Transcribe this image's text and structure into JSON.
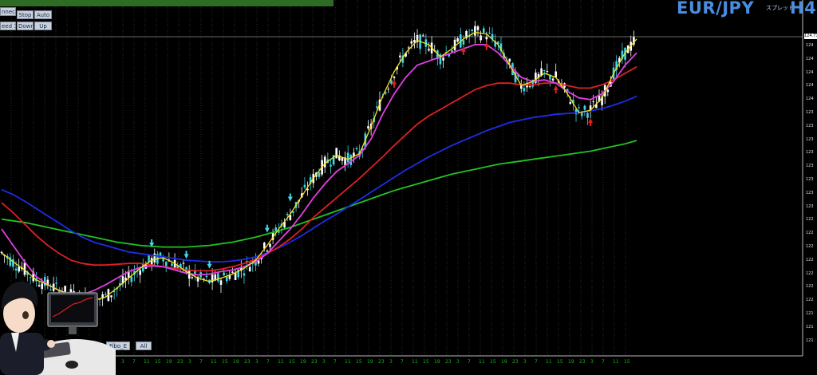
{
  "title": {
    "symbol": "EUR/JPY",
    "subtitle": "スプレット",
    "timeframe": "H4"
  },
  "toolbar": {
    "buttons": [
      {
        "name": "connect-button",
        "label": "nnect"
      },
      {
        "name": "stop-button",
        "label": "Stop"
      },
      {
        "name": "auto-button",
        "label": "Auto"
      },
      {
        "name": "speed-button",
        "label": "eed 1"
      },
      {
        "name": "down-button",
        "label": "Down"
      },
      {
        "name": "up-button",
        "label": "Up"
      }
    ]
  },
  "bottom_buttons": [
    {
      "name": "fibo-e-button",
      "label": "Fibo_E"
    },
    {
      "name": "all-button",
      "label": "All"
    }
  ],
  "colors": {
    "background": "#000000",
    "bull": "#ffffff",
    "bear": "#3fd6e6",
    "sma_fast": "#f5e21b",
    "sma_mid": "#e040e0",
    "sma_red": "#e02020",
    "sma_blue": "#1f2ce8",
    "sma_green": "#22c322",
    "arrow_up": "#e02020",
    "arrow_down": "#3fd6e6",
    "grid": "#555555",
    "axis_text": "#1db31d"
  },
  "chart_data": {
    "type": "line",
    "chart_kind": "candlestick-with-moving-averages",
    "title": "EUR/JPY H4",
    "ylim": [
      121.2,
      124.9
    ],
    "x_tick_labels": [
      "11",
      "15",
      "19",
      "23",
      "3",
      "7",
      "11",
      "15",
      "19",
      "23",
      "3",
      "7",
      "11",
      "15",
      "19",
      "23",
      "3",
      "7",
      "11",
      "15",
      "19",
      "23",
      "3",
      "7",
      "11",
      "15",
      "19",
      "23",
      "3",
      "7",
      "11",
      "15",
      "19",
      "23",
      "3",
      "7",
      "11",
      "15",
      "19",
      "23",
      "3",
      "7",
      "11",
      "15",
      "19",
      "23",
      "3",
      "7",
      "11",
      "15",
      "19",
      "23",
      "3",
      "7",
      "11",
      "15"
    ],
    "y_tick_labels": [
      "124",
      "124",
      "124",
      "124",
      "124",
      "123",
      "123",
      "123",
      "123",
      "123",
      "123",
      "123",
      "123",
      "122",
      "122",
      "122",
      "122",
      "122",
      "122",
      "122",
      "121",
      "121",
      "121"
    ],
    "current_price": "124.77",
    "series": [
      {
        "name": "Yellow",
        "color": "#f5e21b",
        "values": [
          122.01,
          121.9,
          121.8,
          121.68,
          121.62,
          121.55,
          121.5,
          121.45,
          121.43,
          121.47,
          121.58,
          121.7,
          121.82,
          121.92,
          121.95,
          121.88,
          121.78,
          121.7,
          121.66,
          121.7,
          121.75,
          121.82,
          121.92,
          122.1,
          122.3,
          122.48,
          122.7,
          122.92,
          123.1,
          123.2,
          123.15,
          123.22,
          123.55,
          123.92,
          124.22,
          124.45,
          124.6,
          124.55,
          124.4,
          124.5,
          124.62,
          124.7,
          124.68,
          124.55,
          124.3,
          124.05,
          124.1,
          124.2,
          124.15,
          123.95,
          123.72,
          123.75,
          123.9,
          124.2,
          124.45,
          124.62
        ]
      },
      {
        "name": "Magenta",
        "color": "#e040e0",
        "values": [
          122.3,
          122.1,
          121.9,
          121.72,
          121.62,
          121.55,
          121.5,
          121.5,
          121.55,
          121.62,
          121.7,
          121.78,
          121.83,
          121.85,
          121.84,
          121.8,
          121.76,
          121.74,
          121.75,
          121.78,
          121.8,
          121.84,
          121.9,
          122.0,
          122.15,
          122.3,
          122.48,
          122.68,
          122.85,
          123.0,
          123.1,
          123.2,
          123.4,
          123.7,
          123.95,
          124.15,
          124.3,
          124.35,
          124.4,
          124.45,
          124.5,
          124.55,
          124.55,
          124.45,
          124.3,
          124.15,
          124.1,
          124.12,
          124.08,
          123.98,
          123.9,
          123.88,
          123.95,
          124.1,
          124.3,
          124.45
        ]
      },
      {
        "name": "Red",
        "color": "#e02020",
        "values": [
          122.62,
          122.5,
          122.36,
          122.22,
          122.1,
          122.0,
          121.92,
          121.88,
          121.86,
          121.86,
          121.87,
          121.88,
          121.88,
          121.86,
          121.84,
          121.82,
          121.8,
          121.79,
          121.79,
          121.81,
          121.84,
          121.88,
          121.93,
          122.0,
          122.08,
          122.18,
          122.3,
          122.44,
          122.56,
          122.68,
          122.8,
          122.92,
          123.05,
          123.18,
          123.32,
          123.45,
          123.58,
          123.68,
          123.76,
          123.84,
          123.92,
          124.0,
          124.05,
          124.08,
          124.08,
          124.06,
          124.06,
          124.08,
          124.08,
          124.05,
          124.02,
          124.02,
          124.06,
          124.12,
          124.2,
          124.28
        ]
      },
      {
        "name": "Blue",
        "color": "#1f2ce8",
        "values": [
          122.78,
          122.72,
          122.64,
          122.55,
          122.46,
          122.37,
          122.28,
          122.2,
          122.14,
          122.1,
          122.06,
          122.02,
          122.0,
          121.98,
          121.96,
          121.94,
          121.92,
          121.91,
          121.9,
          121.9,
          121.91,
          121.93,
          121.96,
          122.01,
          122.07,
          122.14,
          122.22,
          122.31,
          122.4,
          122.48,
          122.57,
          122.66,
          122.75,
          122.84,
          122.93,
          123.02,
          123.1,
          123.18,
          123.25,
          123.32,
          123.38,
          123.44,
          123.5,
          123.55,
          123.6,
          123.63,
          123.66,
          123.68,
          123.7,
          123.71,
          123.72,
          123.74,
          123.77,
          123.81,
          123.86,
          123.92
        ]
      },
      {
        "name": "Green",
        "color": "#22c322",
        "values": [
          122.42,
          122.4,
          122.38,
          122.35,
          122.32,
          122.29,
          122.26,
          122.23,
          122.2,
          122.17,
          122.14,
          122.12,
          122.1,
          122.09,
          122.08,
          122.08,
          122.08,
          122.09,
          122.1,
          122.12,
          122.14,
          122.17,
          122.2,
          122.24,
          122.28,
          122.32,
          122.37,
          122.42,
          122.47,
          122.52,
          122.57,
          122.62,
          122.67,
          122.72,
          122.77,
          122.81,
          122.85,
          122.89,
          122.93,
          122.97,
          123.0,
          123.03,
          123.06,
          123.09,
          123.11,
          123.13,
          123.15,
          123.17,
          123.19,
          123.21,
          123.23,
          123.25,
          123.28,
          123.31,
          123.34,
          123.38
        ]
      }
    ]
  }
}
